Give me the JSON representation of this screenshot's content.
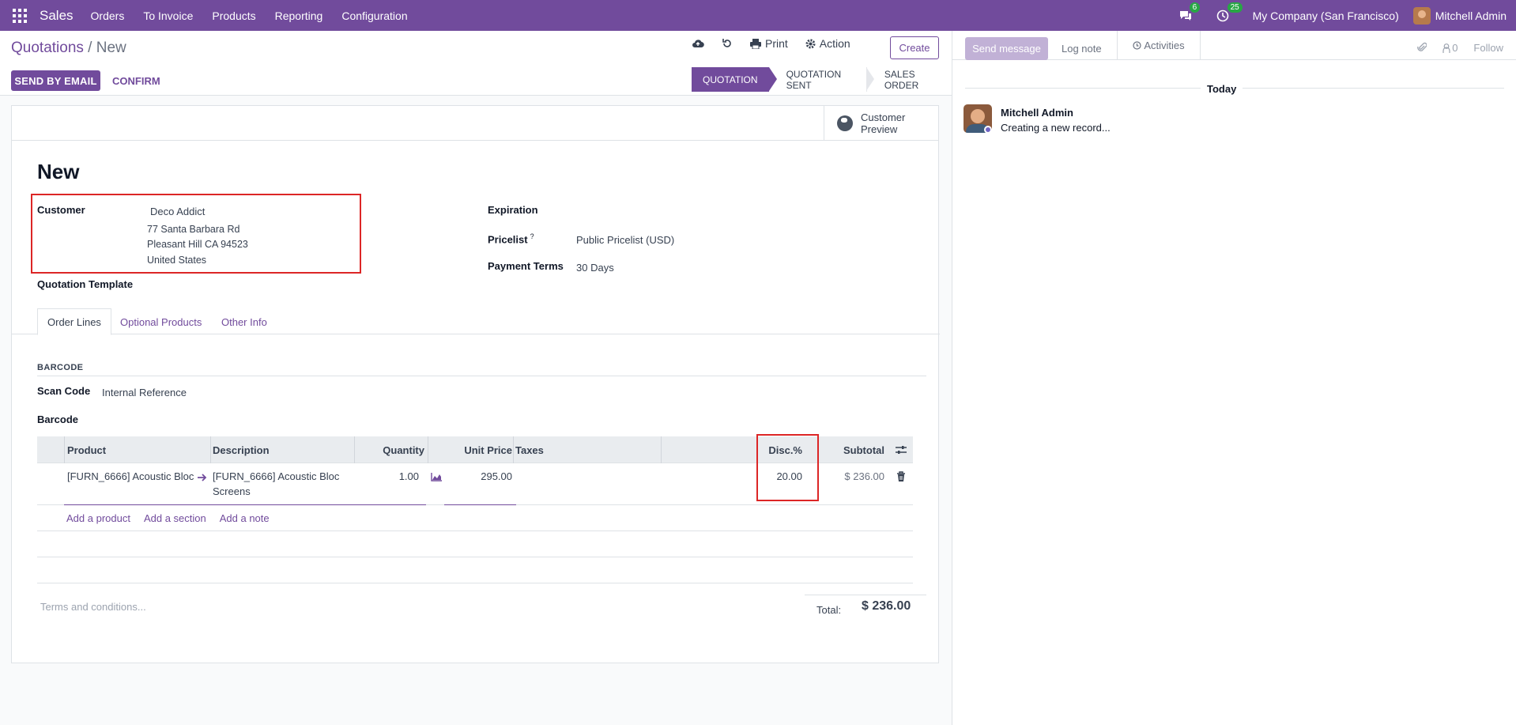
{
  "navbar": {
    "app_name": "Sales",
    "menu": [
      "Orders",
      "To Invoice",
      "Products",
      "Reporting",
      "Configuration"
    ],
    "messages_count": "6",
    "activities_count": "25",
    "company": "My Company (San Francisco)",
    "user": "Mitchell Admin"
  },
  "breadcrumb": {
    "parent": "Quotations",
    "separator": " / ",
    "current": "New"
  },
  "toolbar": {
    "print_label": "Print",
    "action_label": "Action",
    "create_label": "Create"
  },
  "buttons": {
    "send_by_email": "SEND BY EMAIL",
    "confirm": "CONFIRM"
  },
  "statusbar": [
    "QUOTATION",
    "QUOTATION SENT",
    "SALES ORDER"
  ],
  "customer_preview": {
    "line1": "Customer",
    "line2": "Preview"
  },
  "record": {
    "title": "New",
    "customer_label": "Customer",
    "customer_name": "Deco Addict",
    "customer_address": [
      "77 Santa Barbara Rd",
      "Pleasant Hill CA 94523",
      "United States"
    ],
    "quotation_template_label": "Quotation Template",
    "expiration_label": "Expiration",
    "pricelist_label": "Pricelist",
    "pricelist_help": "?",
    "pricelist_value": "Public Pricelist (USD)",
    "payment_terms_label": "Payment Terms",
    "payment_terms_value": "30 Days"
  },
  "tabs": [
    "Order Lines",
    "Optional Products",
    "Other Info"
  ],
  "barcode": {
    "section_title": "BARCODE",
    "scan_code_label": "Scan Code",
    "scan_code_value": "Internal Reference",
    "barcode_label": "Barcode"
  },
  "order_lines": {
    "columns": [
      "Product",
      "Description",
      "Quantity",
      "Unit Price",
      "Taxes",
      "Disc.%",
      "Subtotal"
    ],
    "rows": [
      {
        "product": "[FURN_6666] Acoustic Bloc",
        "description_1": "[FURN_6666] Acoustic Bloc",
        "description_2": "Screens",
        "quantity": "1.00",
        "unit_price": "295.00",
        "taxes": "",
        "discount": "20.00",
        "subtotal": "$ 236.00"
      }
    ],
    "add_links": [
      "Add a product",
      "Add a section",
      "Add a note"
    ]
  },
  "terms_placeholder": "Terms and conditions...",
  "totals": {
    "label": "Total:",
    "value": "$ 236.00"
  },
  "chatter": {
    "send_message": "Send message",
    "log_note": "Log note",
    "activities": "Activities",
    "followers_count": "0",
    "follow": "Follow",
    "date_separator": "Today",
    "message_author": "Mitchell Admin",
    "message_body": "Creating a new record..."
  },
  "colors": {
    "brand": "#714b9c",
    "highlight": "#dc2626",
    "badge": "#28a745"
  }
}
